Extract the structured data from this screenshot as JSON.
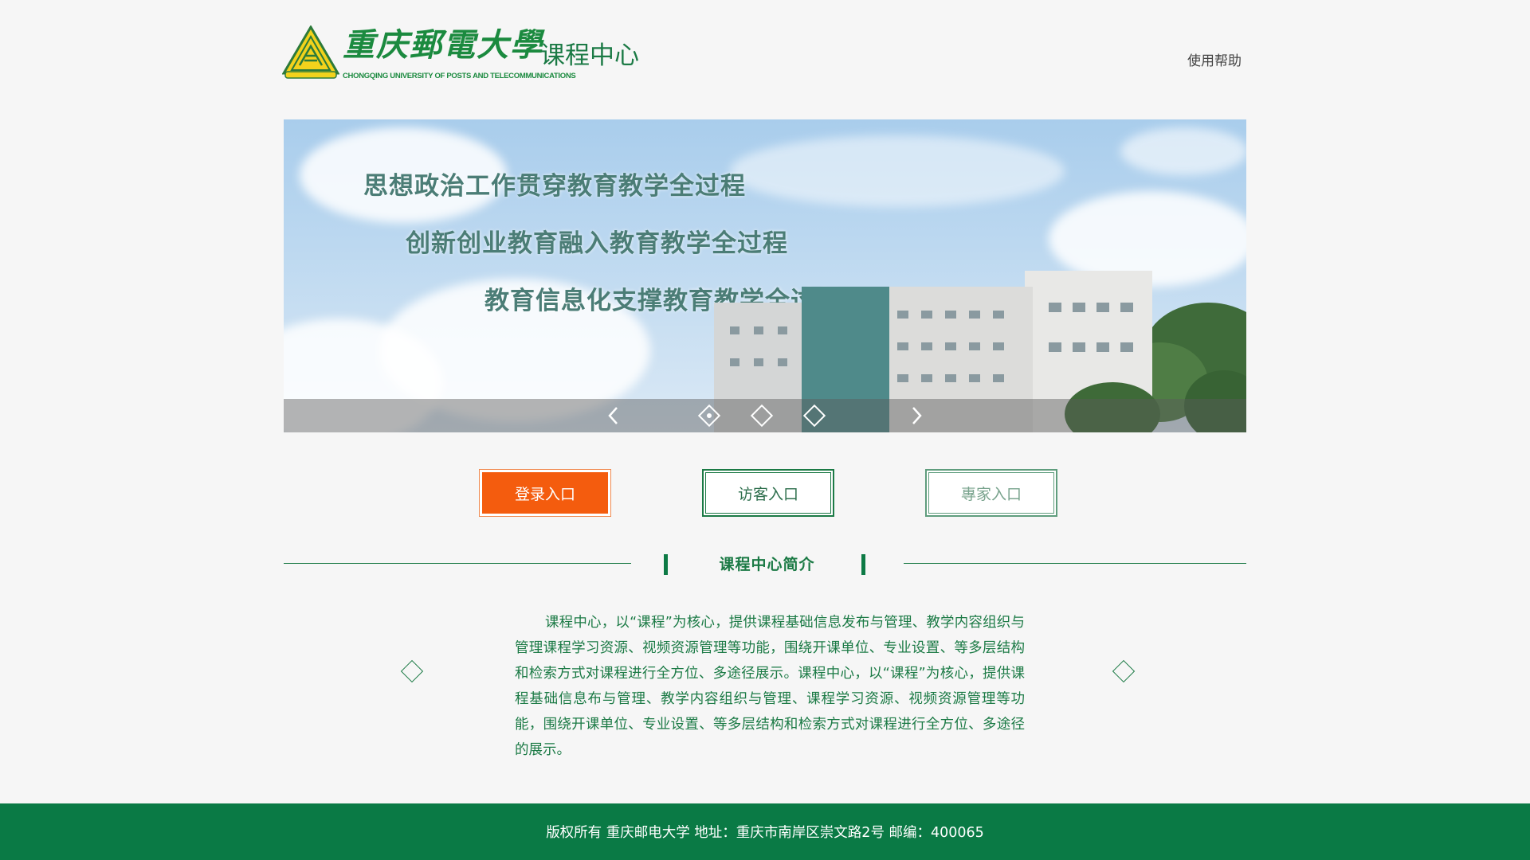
{
  "header": {
    "logo_cn": "重庆郵電大學",
    "logo_en": "CHONGQING UNIVERSITY OF POSTS AND TELECOMMUNICATIONS",
    "site_title": "课程中心",
    "help_label": "使用帮助"
  },
  "banner": {
    "slogans": [
      "思想政治工作贯穿教育教学全过程",
      "创新创业教育融入教育教学全过程",
      "教育信息化支撑教育教学全过程"
    ],
    "slides": 3,
    "active_slide": 1
  },
  "entries": {
    "login_label": "登录入口",
    "guest_label": "访客入口",
    "expert_label": "專家入口"
  },
  "intro": {
    "title": "课程中心简介",
    "body": "课程中心，以“课程”为核心，提供课程基础信息发布与管理、教学内容组织与管理课程学习资源、视频资源管理等功能，围绕开课单位、专业设置、等多层结构和检索方式对课程进行全方位、多途径展示。课程中心，以“课程”为核心，提供课程基础信息布与管理、教学内容组织与管理、课程学习资源、视频资源管理等功能，围绕开课单位、专业设置、等多层结构和检索方式对课程进行全方位、多途径的展示。"
  },
  "footer": {
    "text": "版权所有 重庆邮电大学 地址：重庆市南岸区崇文路2号 邮编：400065"
  },
  "colors": {
    "brand_green": "#1b7a45",
    "footer_green": "#0a7a45",
    "login_orange": "#f45c0e",
    "page_bg": "#f6f6f6"
  }
}
